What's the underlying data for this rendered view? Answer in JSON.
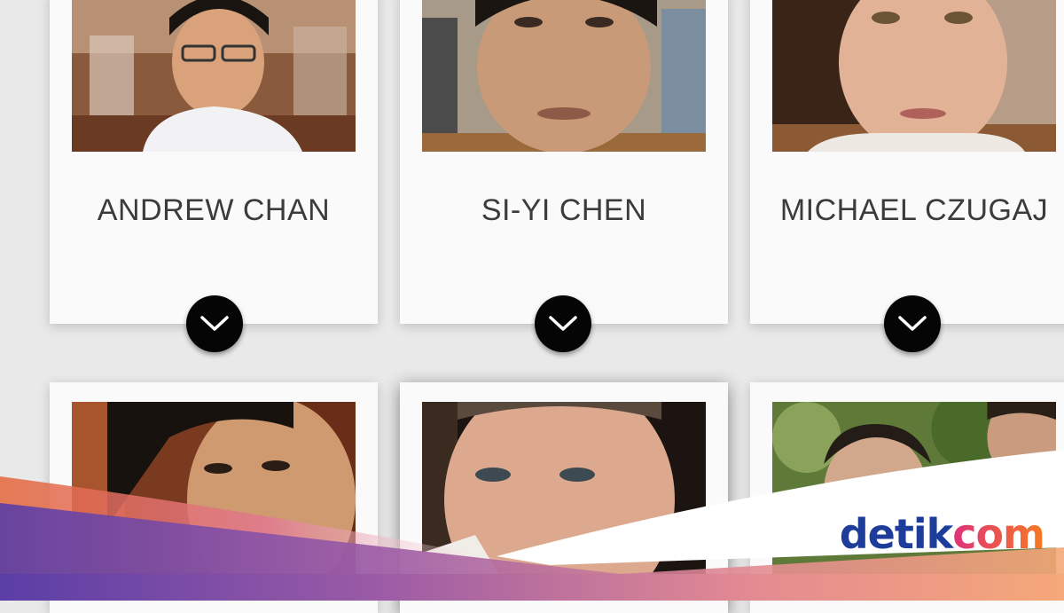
{
  "profiles": [
    {
      "name": "ANDREW CHAN"
    },
    {
      "name": "SI-YI CHEN"
    },
    {
      "name": "MICHAEL CZUGAJ"
    },
    {
      "name": ""
    },
    {
      "name": ""
    },
    {
      "name": ""
    }
  ],
  "logo": {
    "brand": "detik",
    "suffix": "com"
  },
  "icons": {
    "expand": "chevron-down-icon"
  },
  "colors": {
    "card": "#fafafa",
    "background": "#e9e9e9",
    "button": "#050505",
    "logo_blue": "#1e3c9a",
    "logo_gradient_start": "#e0317a",
    "logo_gradient_end": "#f57b22"
  }
}
